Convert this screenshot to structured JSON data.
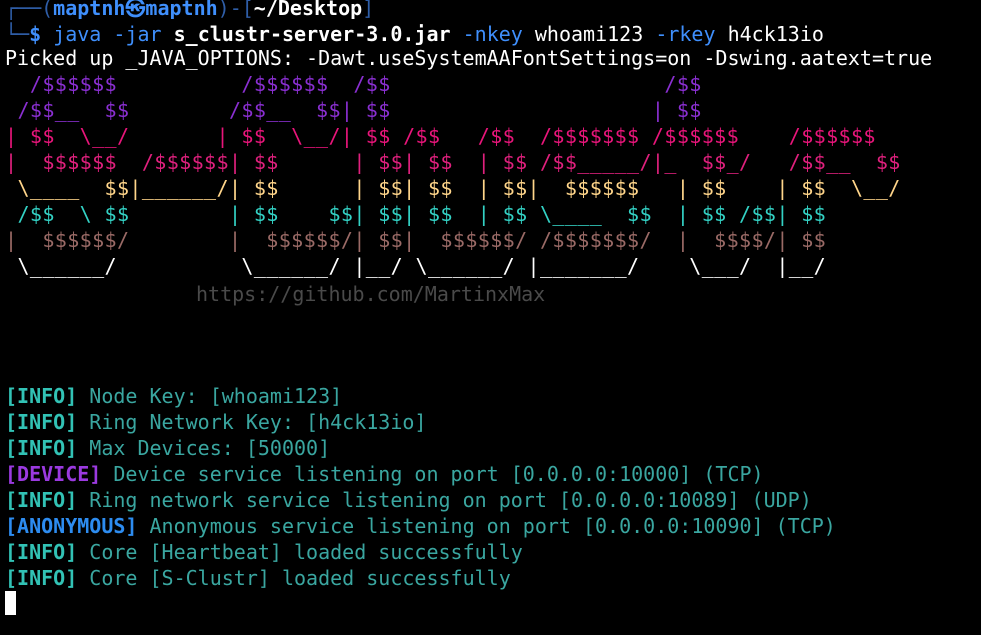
{
  "prompt": {
    "frame_top": "┌──(",
    "user_host": "maptnh㉿maptnh",
    "frame_mid": ")-[",
    "path": "~/Desktop",
    "frame_end": "]",
    "frame_bottom": "└─",
    "symbol": "$",
    "cmd": "java",
    "flag_jar": "-jar",
    "jar": "s_clustr-server-3.0.jar",
    "flag_nkey": "-nkey",
    "nkey": "whoami123",
    "flag_rkey": "-rkey",
    "rkey": "h4ck13io"
  },
  "java_options": "Picked up _JAVA_OPTIONS: -Dawt.useSystemAAFontSettings=on -Dswing.aatext=true",
  "banner": [
    "  /$$$$$$          /$$$$$$  /$$                      /$$",
    " /$$__  $$        /$$__  $$| $$                     | $$",
    "| $$  \\__/       | $$  \\__/| $$ /$$   /$$  /$$$$$$$ /$$$$$$    /$$$$$$",
    "|  $$$$$$  /$$$$$$| $$      | $$| $$  | $$ /$$_____/|_  $$_/   /$$__  $$",
    " \\____  $$|______/| $$      | $$| $$  | $$|  $$$$$$   | $$    | $$  \\__/",
    " /$$  \\ $$        | $$    $$| $$| $$  | $$ \\____  $$  | $$ /$$| $$",
    "|  $$$$$$/        |  $$$$$$/| $$|  $$$$$$/ /$$$$$$$/  |  $$$$/| $$",
    " \\______/          \\______/ |__/ \\______/ |_______/    \\___/  |__/"
  ],
  "watermark": "https://github.com/MartinxMax",
  "logs": [
    {
      "tag": "[INFO]",
      "message": "Node Key: [whoami123]"
    },
    {
      "tag": "[INFO]",
      "message": "Ring Network Key: [h4ck13io]"
    },
    {
      "tag": "[INFO]",
      "message": "Max Devices: [50000]"
    },
    {
      "tag": "[DEVICE]",
      "message": "Device service listening on port [0.0.0.0:10000] (TCP)"
    },
    {
      "tag": "[INFO]",
      "message": "Ring network service listening on port [0.0.0.0:10089] (UDP)"
    },
    {
      "tag": "[ANONYMOUS]",
      "message": "Anonymous service listening on port [0.0.0.0:10090] (TCP)"
    },
    {
      "tag": "[INFO]",
      "message": "Core [Heartbeat] loaded successfully"
    },
    {
      "tag": "[INFO]",
      "message": "Core [S-Clustr] loaded successfully"
    }
  ],
  "colors": {
    "background": "#000000",
    "prompt_blue": "#3f8ffc",
    "info_cyan": "#32c2b5",
    "device_purple": "#9b3ae0",
    "anonymous_blue": "#2d8cf0",
    "banner_purple": "#8a2fd1",
    "banner_pink": "#e8157a",
    "banner_yellow": "#ffd58a",
    "banner_teal": "#33d1c4",
    "banner_brown": "#9a6a66"
  }
}
